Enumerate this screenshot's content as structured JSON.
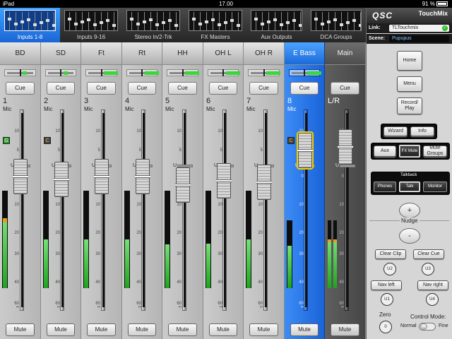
{
  "statusbar": {
    "device": "iPad",
    "time": "17.00",
    "battery": "91 %"
  },
  "tabs": [
    {
      "label": "Inputs 1-8",
      "active": true
    },
    {
      "label": "Inputs 9-16",
      "active": false
    },
    {
      "label": "Stereo In/2-Trk",
      "active": false
    },
    {
      "label": "FX Masters",
      "active": false
    },
    {
      "label": "Aux Outputs",
      "active": false
    },
    {
      "label": "DCA Groups",
      "active": false
    }
  ],
  "channels": [
    {
      "name": "BD",
      "cue": "Cue",
      "number": "1",
      "type": "Mic",
      "badge": "G",
      "fader_db": 0,
      "meter_level": 0.72,
      "peak": true,
      "mute": "Mute"
    },
    {
      "name": "SD",
      "cue": "Cue",
      "number": "2",
      "type": "Mic",
      "badge": "C",
      "fader_db": -1,
      "meter_level": 0.5,
      "peak": false,
      "mute": "Mute"
    },
    {
      "name": "Ft",
      "cue": "Cue",
      "number": "3",
      "type": "Mic",
      "badge": "",
      "fader_db": 0,
      "meter_level": 0.5,
      "peak": false,
      "mute": "Mute"
    },
    {
      "name": "Rt",
      "cue": "Cue",
      "number": "4",
      "type": "Mic",
      "badge": "",
      "fader_db": 0,
      "meter_level": 0.5,
      "peak": false,
      "mute": "Mute"
    },
    {
      "name": "HH",
      "cue": "Cue",
      "number": "5",
      "type": "Mic",
      "badge": "",
      "fader_db": -3,
      "meter_level": 0.45,
      "peak": false,
      "mute": "Mute"
    },
    {
      "name": "OH L",
      "cue": "Cue",
      "number": "6",
      "type": "Mic",
      "badge": "",
      "fader_db": -1.5,
      "meter_level": 0.46,
      "peak": false,
      "mute": "Mute"
    },
    {
      "name": "OH R",
      "cue": "Cue",
      "number": "7",
      "type": "Mic",
      "badge": "",
      "fader_db": -2,
      "meter_level": 0.5,
      "peak": false,
      "mute": "Mute"
    },
    {
      "name": "E Bass",
      "cue": "Cue",
      "number": "8",
      "type": "Mic",
      "badge": "C",
      "fader_db": 5,
      "meter_level": 0.62,
      "peak": false,
      "mute": "Mute",
      "selected": true
    },
    {
      "name": "Main",
      "cue": "Cue",
      "number": "L/R",
      "type": "",
      "badge": "",
      "fader_db": 6,
      "meter_level": 0.72,
      "peak": true,
      "mute": "Mute",
      "main": true
    }
  ],
  "fader_scale": [
    "10",
    "5",
    "U",
    "0",
    "10",
    "20",
    "30",
    "40",
    "60",
    "∞"
  ],
  "side": {
    "brand": "QSC",
    "product": "TouchMix",
    "link_label": "Link:",
    "link_value": "TLTouchmix",
    "link_ok": "✓",
    "scene_label": "Scene:",
    "scene_value": "Pupupus",
    "home": "Home",
    "menu": "Menu",
    "record": "Record/ Play",
    "wizard": "Wizard",
    "info": "Info",
    "aux": "Aux",
    "fx_mute": "FX Mute",
    "mute_groups": "Mute Groups",
    "talkback": "Talkback",
    "phones": "Phones",
    "talk": "Talk",
    "monitor": "Monitor",
    "nudge": "Nudge",
    "up": "▲",
    "down": "▼",
    "plus": "+",
    "minus": "-",
    "clear_clip": "Clear Clip",
    "clear_cue": "Clear Cue",
    "u2": "U2",
    "u3": "U3",
    "nav_left": "Nav left",
    "nav_right": "Nav right",
    "u1": "U1",
    "u4": "U4",
    "zero": "Zero",
    "zero_val": "0",
    "control_mode": "Control Mode:",
    "normal": "Normal",
    "fine": "Fine"
  }
}
